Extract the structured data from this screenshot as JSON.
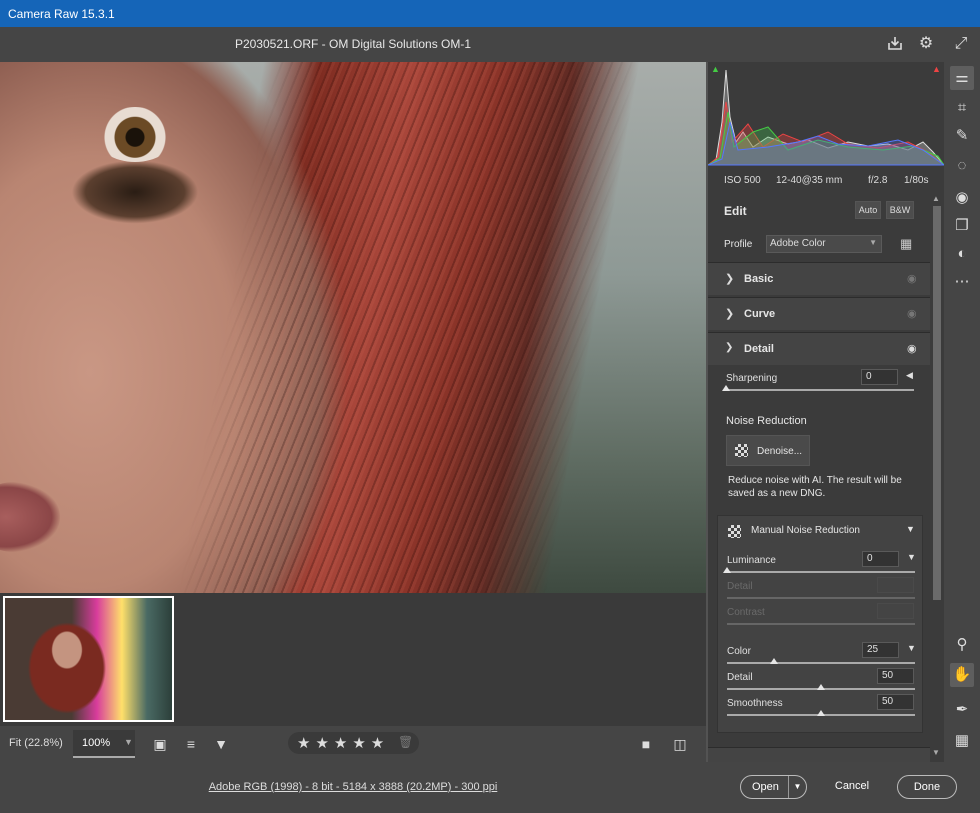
{
  "app": {
    "title": "Camera Raw 15.3.1"
  },
  "header": {
    "filename": "P2030521.ORF  -  OM Digital Solutions OM-1",
    "icons": [
      "save-icon",
      "gear-icon",
      "fullscreen-icon"
    ]
  },
  "camera_info": {
    "iso": "ISO 500",
    "lens": "12-40@35 mm",
    "aperture": "f/2.8",
    "shutter": "1/80s"
  },
  "edit": {
    "title": "Edit",
    "auto_label": "Auto",
    "bw_label": "B&W",
    "profile_label": "Profile",
    "profile_value": "Adobe Color"
  },
  "sections": {
    "basic": "Basic",
    "curve": "Curve",
    "detail": "Detail"
  },
  "detail": {
    "sharpening": {
      "label": "Sharpening",
      "value": "0",
      "fraction": 0
    },
    "noise_reduction_title": "Noise Reduction",
    "denoise_label": "Denoise...",
    "denoise_note": "Reduce noise with AI. The result will be saved as a new DNG.",
    "manual_title": "Manual Noise Reduction",
    "luminance": {
      "label": "Luminance",
      "value": "0",
      "fraction": 0
    },
    "lum_detail": {
      "label": "Detail",
      "value": ""
    },
    "lum_contrast": {
      "label": "Contrast",
      "value": ""
    },
    "color": {
      "label": "Color",
      "value": "25",
      "fraction": 0.25
    },
    "color_detail": {
      "label": "Detail",
      "value": "50",
      "fraction": 0.5
    },
    "smoothness": {
      "label": "Smoothness",
      "value": "50",
      "fraction": 0.5
    }
  },
  "bottom": {
    "fit_label": "Fit (22.8%)",
    "zoom_value": "100%",
    "stars": "★★★★★",
    "rating": 0,
    "color_info": "Adobe RGB (1998) - 8 bit - 5184 x 3888 (20.2MP) - 300 ppi",
    "open_label": "Open",
    "cancel_label": "Cancel",
    "done_label": "Done"
  },
  "tools": [
    "edit-icon",
    "crop-icon",
    "heal-icon",
    "mask-icon",
    "redeye-icon",
    "snapshots-icon",
    "presets-icon",
    "more-icon",
    "zoom-icon",
    "hand-icon",
    "sampler-icon",
    "grid-icon"
  ],
  "colors": {
    "titlebar": "#1565b8",
    "panel": "#3b3b3b",
    "toolbar": "#454545"
  }
}
